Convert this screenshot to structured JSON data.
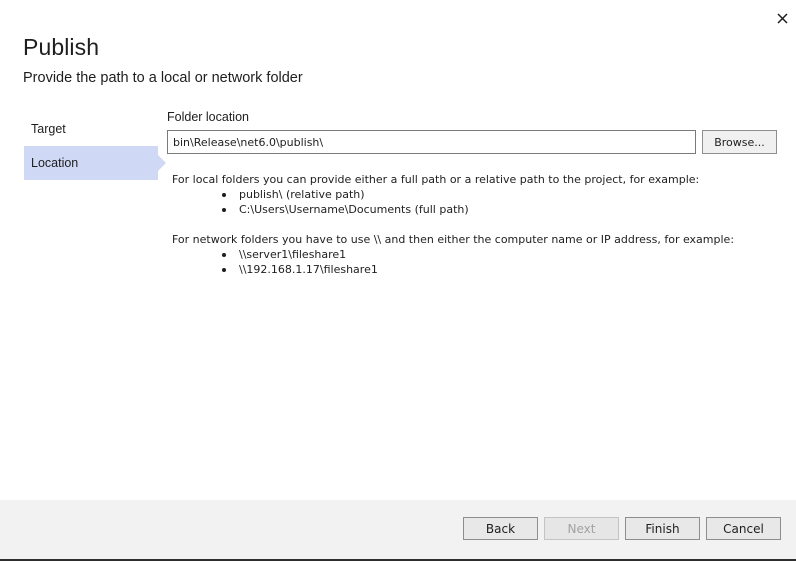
{
  "dialog": {
    "title": "Publish",
    "subtitle": "Provide the path to a local or network folder",
    "close_icon": "close-icon"
  },
  "nav": {
    "items": [
      {
        "label": "Target",
        "selected": false
      },
      {
        "label": "Location",
        "selected": true
      }
    ]
  },
  "location": {
    "field_label": "Folder location",
    "folder_value": "bin\\Release\\net6.0\\publish\\",
    "browse_label": "Browse..."
  },
  "help": {
    "local_intro": "For local folders you can provide either a full path or a relative path to the project, for example:",
    "local_examples": [
      "publish\\ (relative path)",
      "C:\\Users\\Username\\Documents (full path)"
    ],
    "network_intro": "For network folders you have to use \\\\ and then either the computer name or IP address, for example:",
    "network_examples": [
      "\\\\server1\\fileshare1",
      "\\\\192.168.1.17\\fileshare1"
    ]
  },
  "footer": {
    "back_label": "Back",
    "next_label": "Next",
    "finish_label": "Finish",
    "cancel_label": "Cancel"
  },
  "colors": {
    "selected_nav_bg": "#cfd9f5",
    "footer_bg": "#f2f2f2"
  }
}
